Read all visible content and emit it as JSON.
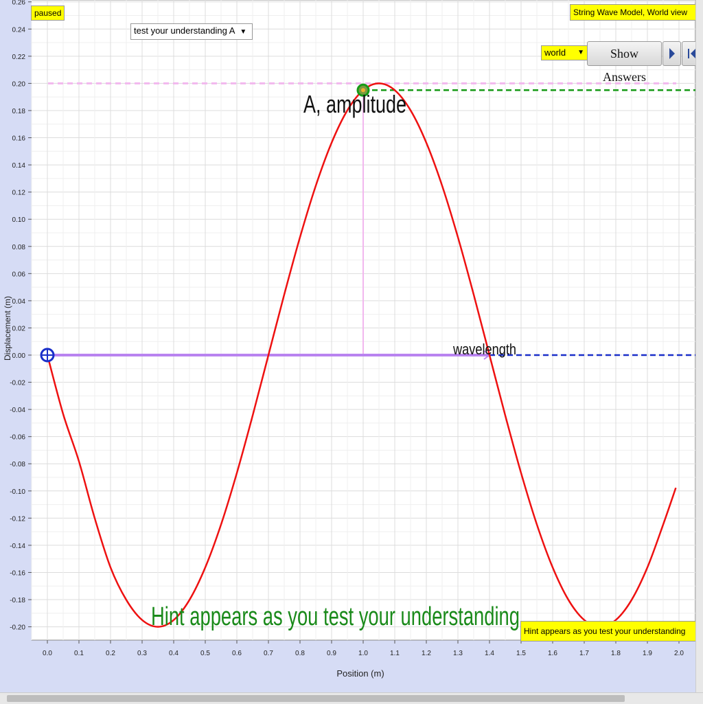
{
  "status": "paused",
  "model_title": "String Wave Model, World view",
  "hint_box": "Hint appears as you test your understanding",
  "hint_text": "Hint appears as you test your understanding",
  "understanding_select": "test your understanding A",
  "view_select": "world",
  "show_answers_label": "Show Answers",
  "amplitude_label": "A, amplitude",
  "wavelength_label": "wavelength",
  "colors": {
    "wave": "#ee1111",
    "wavelength_arrow": "#b983f0",
    "amplitude_line": "#f2b7ee",
    "amplitude_dashed": "#169a16",
    "axis_dashed": "#1a2fc9",
    "hint": "#1a8a1a",
    "badge": "#ffff00"
  },
  "chart_data": {
    "type": "line",
    "xlabel": "Position (m)",
    "ylabel": "Displacement (m)",
    "xlim": [
      0.0,
      2.0
    ],
    "ylim": [
      -0.2,
      0.26
    ],
    "grid": true,
    "x_ticks": [
      "0.0",
      "0.1",
      "0.2",
      "0.3",
      "0.4",
      "0.5",
      "0.6",
      "0.7",
      "0.8",
      "0.9",
      "1.0",
      "1.1",
      "1.2",
      "1.3",
      "1.4",
      "1.5",
      "1.6",
      "1.7",
      "1.8",
      "1.9",
      "2.0"
    ],
    "y_ticks": [
      "0.26",
      "0.24",
      "0.22",
      "0.20",
      "0.18",
      "0.16",
      "0.14",
      "0.12",
      "0.10",
      "0.08",
      "0.06",
      "0.04",
      "0.02",
      "0.00",
      "-0.02",
      "-0.04",
      "-0.06",
      "-0.08",
      "-0.10",
      "-0.12",
      "-0.14",
      "-0.16",
      "-0.18",
      "-0.20"
    ],
    "series": [
      {
        "x": [
          0.0,
          0.05,
          0.1,
          0.15,
          0.2,
          0.25,
          0.3,
          0.35,
          0.4,
          0.45,
          0.5,
          0.55,
          0.6,
          0.65,
          0.7,
          0.75,
          0.8,
          0.85,
          0.9,
          0.95,
          1.0,
          1.05,
          1.1,
          1.15,
          1.2,
          1.25,
          1.3,
          1.35,
          1.4,
          1.45,
          1.5,
          1.55,
          1.6,
          1.65,
          1.7,
          1.75,
          1.8,
          1.85,
          1.9,
          1.95,
          1.99
        ],
        "y": [
          0.0,
          -0.0434,
          -0.0782,
          -0.1201,
          -0.1563,
          -0.1802,
          -0.195,
          -0.2,
          -0.195,
          -0.1802,
          -0.1563,
          -0.1247,
          -0.0868,
          -0.0445,
          0.0,
          0.0445,
          0.0868,
          0.1247,
          0.1563,
          0.1802,
          0.195,
          0.2,
          0.195,
          0.1802,
          0.1563,
          0.1247,
          0.0868,
          0.0445,
          0.0,
          -0.0445,
          -0.0868,
          -0.1247,
          -0.1563,
          -0.1802,
          -0.195,
          -0.2,
          -0.195,
          -0.1802,
          -0.1563,
          -0.1247,
          -0.0977
        ]
      }
    ],
    "wavelength": {
      "x_start": 0.0,
      "x_end": 1.4,
      "y": 0.0
    },
    "amplitude_marker": {
      "x": 1.0,
      "y": 0.195
    },
    "amplitude_reference": 0.2
  }
}
